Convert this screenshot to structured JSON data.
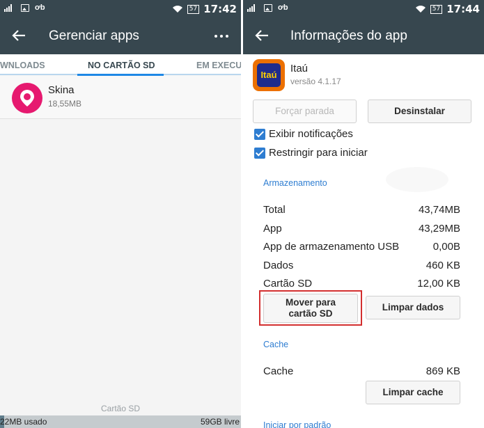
{
  "left": {
    "status": {
      "time": "17:42",
      "battery": "57"
    },
    "appbar": {
      "title": "Gerenciar apps"
    },
    "tabs": [
      {
        "label": "WNLOADS",
        "active": false
      },
      {
        "label": "NO CARTÃO SD",
        "active": true
      },
      {
        "label": "EM EXECU",
        "active": false
      }
    ],
    "apps": [
      {
        "name": "Skina",
        "size": "18,55MB",
        "icon": "skina-logo-icon"
      }
    ],
    "storage": {
      "label": "Cartão SD",
      "used": "22MB usado",
      "free": "59GB livre"
    }
  },
  "right": {
    "status": {
      "time": "17:44",
      "battery": "57"
    },
    "appbar": {
      "title": "Informações do app"
    },
    "app": {
      "name": "Itaú",
      "version": "versão 4.1.17",
      "icon_text": "Itaú"
    },
    "buttons": {
      "force_stop": "Forçar parada",
      "uninstall": "Desinstalar"
    },
    "checkboxes": [
      {
        "label": "Exibir notificações",
        "checked": true
      },
      {
        "label": "Restringir para iniciar",
        "checked": true
      }
    ],
    "storage": {
      "heading": "Armazenamento",
      "rows": [
        {
          "key": "Total",
          "value": "43,74MB"
        },
        {
          "key": "App",
          "value": "43,29MB"
        },
        {
          "key": "App de armazenamento USB",
          "value": "0,00B"
        },
        {
          "key": "Dados",
          "value": "460 KB"
        },
        {
          "key": "Cartão SD",
          "value": "12,00 KB"
        }
      ],
      "move_button": "Mover para cartão SD",
      "clear_data_button": "Limpar dados"
    },
    "cache": {
      "heading": "Cache",
      "key": "Cache",
      "value": "869 KB",
      "clear_cache_button": "Limpar cache"
    },
    "launch": {
      "heading": "Iniciar por padrão"
    }
  },
  "colors": {
    "appbar": "#37474f",
    "accent": "#2e7dd1",
    "highlight": "#d32f2f",
    "skina": "#e6196f",
    "itau_orange": "#ec7000",
    "itau_blue": "#1f2c8c"
  }
}
